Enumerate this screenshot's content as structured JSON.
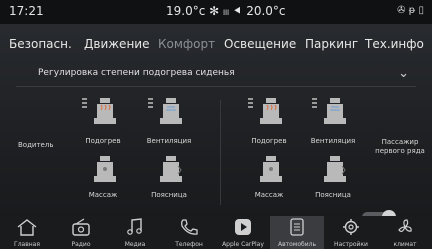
{
  "status": {
    "time": "17:21",
    "climate": "19.0°c ✻ ₗₗₗ ⯇ 20.0°c",
    "icons": "✇ ᵽ ▯"
  },
  "tabs": [
    {
      "label": "Безопасн."
    },
    {
      "label": "Движение"
    },
    {
      "label": "Комфорт",
      "active": true
    },
    {
      "label": "Освещение"
    },
    {
      "label": "Паркинг"
    },
    {
      "label": "Тех.инфо"
    }
  ],
  "section": {
    "title": "Регулировка степени подогрева сиденья"
  },
  "driver": {
    "label": "Водитель",
    "tiles": [
      {
        "label": "Подогрев"
      },
      {
        "label": "Вентиляция"
      },
      {
        "label": "Массаж"
      },
      {
        "label": "Поясница"
      }
    ]
  },
  "passenger": {
    "label": "Пассажир первого ряда",
    "tiles": [
      {
        "label": "Подогрев"
      },
      {
        "label": "Вентиляция"
      },
      {
        "label": "Массаж"
      },
      {
        "label": "Поясница"
      }
    ]
  },
  "nav": [
    {
      "label": "Главная",
      "icon": "home-icon"
    },
    {
      "label": "Радио",
      "icon": "radio-icon"
    },
    {
      "label": "Медиа",
      "icon": "music-icon"
    },
    {
      "label": "Телефон",
      "icon": "phone-icon"
    },
    {
      "label": "Apple CarPlay",
      "icon": "carplay-icon"
    },
    {
      "label": "Автомобиль",
      "icon": "car-settings-icon",
      "active": true
    },
    {
      "label": "Настройки",
      "icon": "gear-icon"
    },
    {
      "label": "климат",
      "icon": "fan-icon"
    }
  ],
  "colors": {
    "accent_active": "#8c8f93",
    "background": "#1e2023",
    "icon": "#b9b9b9"
  }
}
